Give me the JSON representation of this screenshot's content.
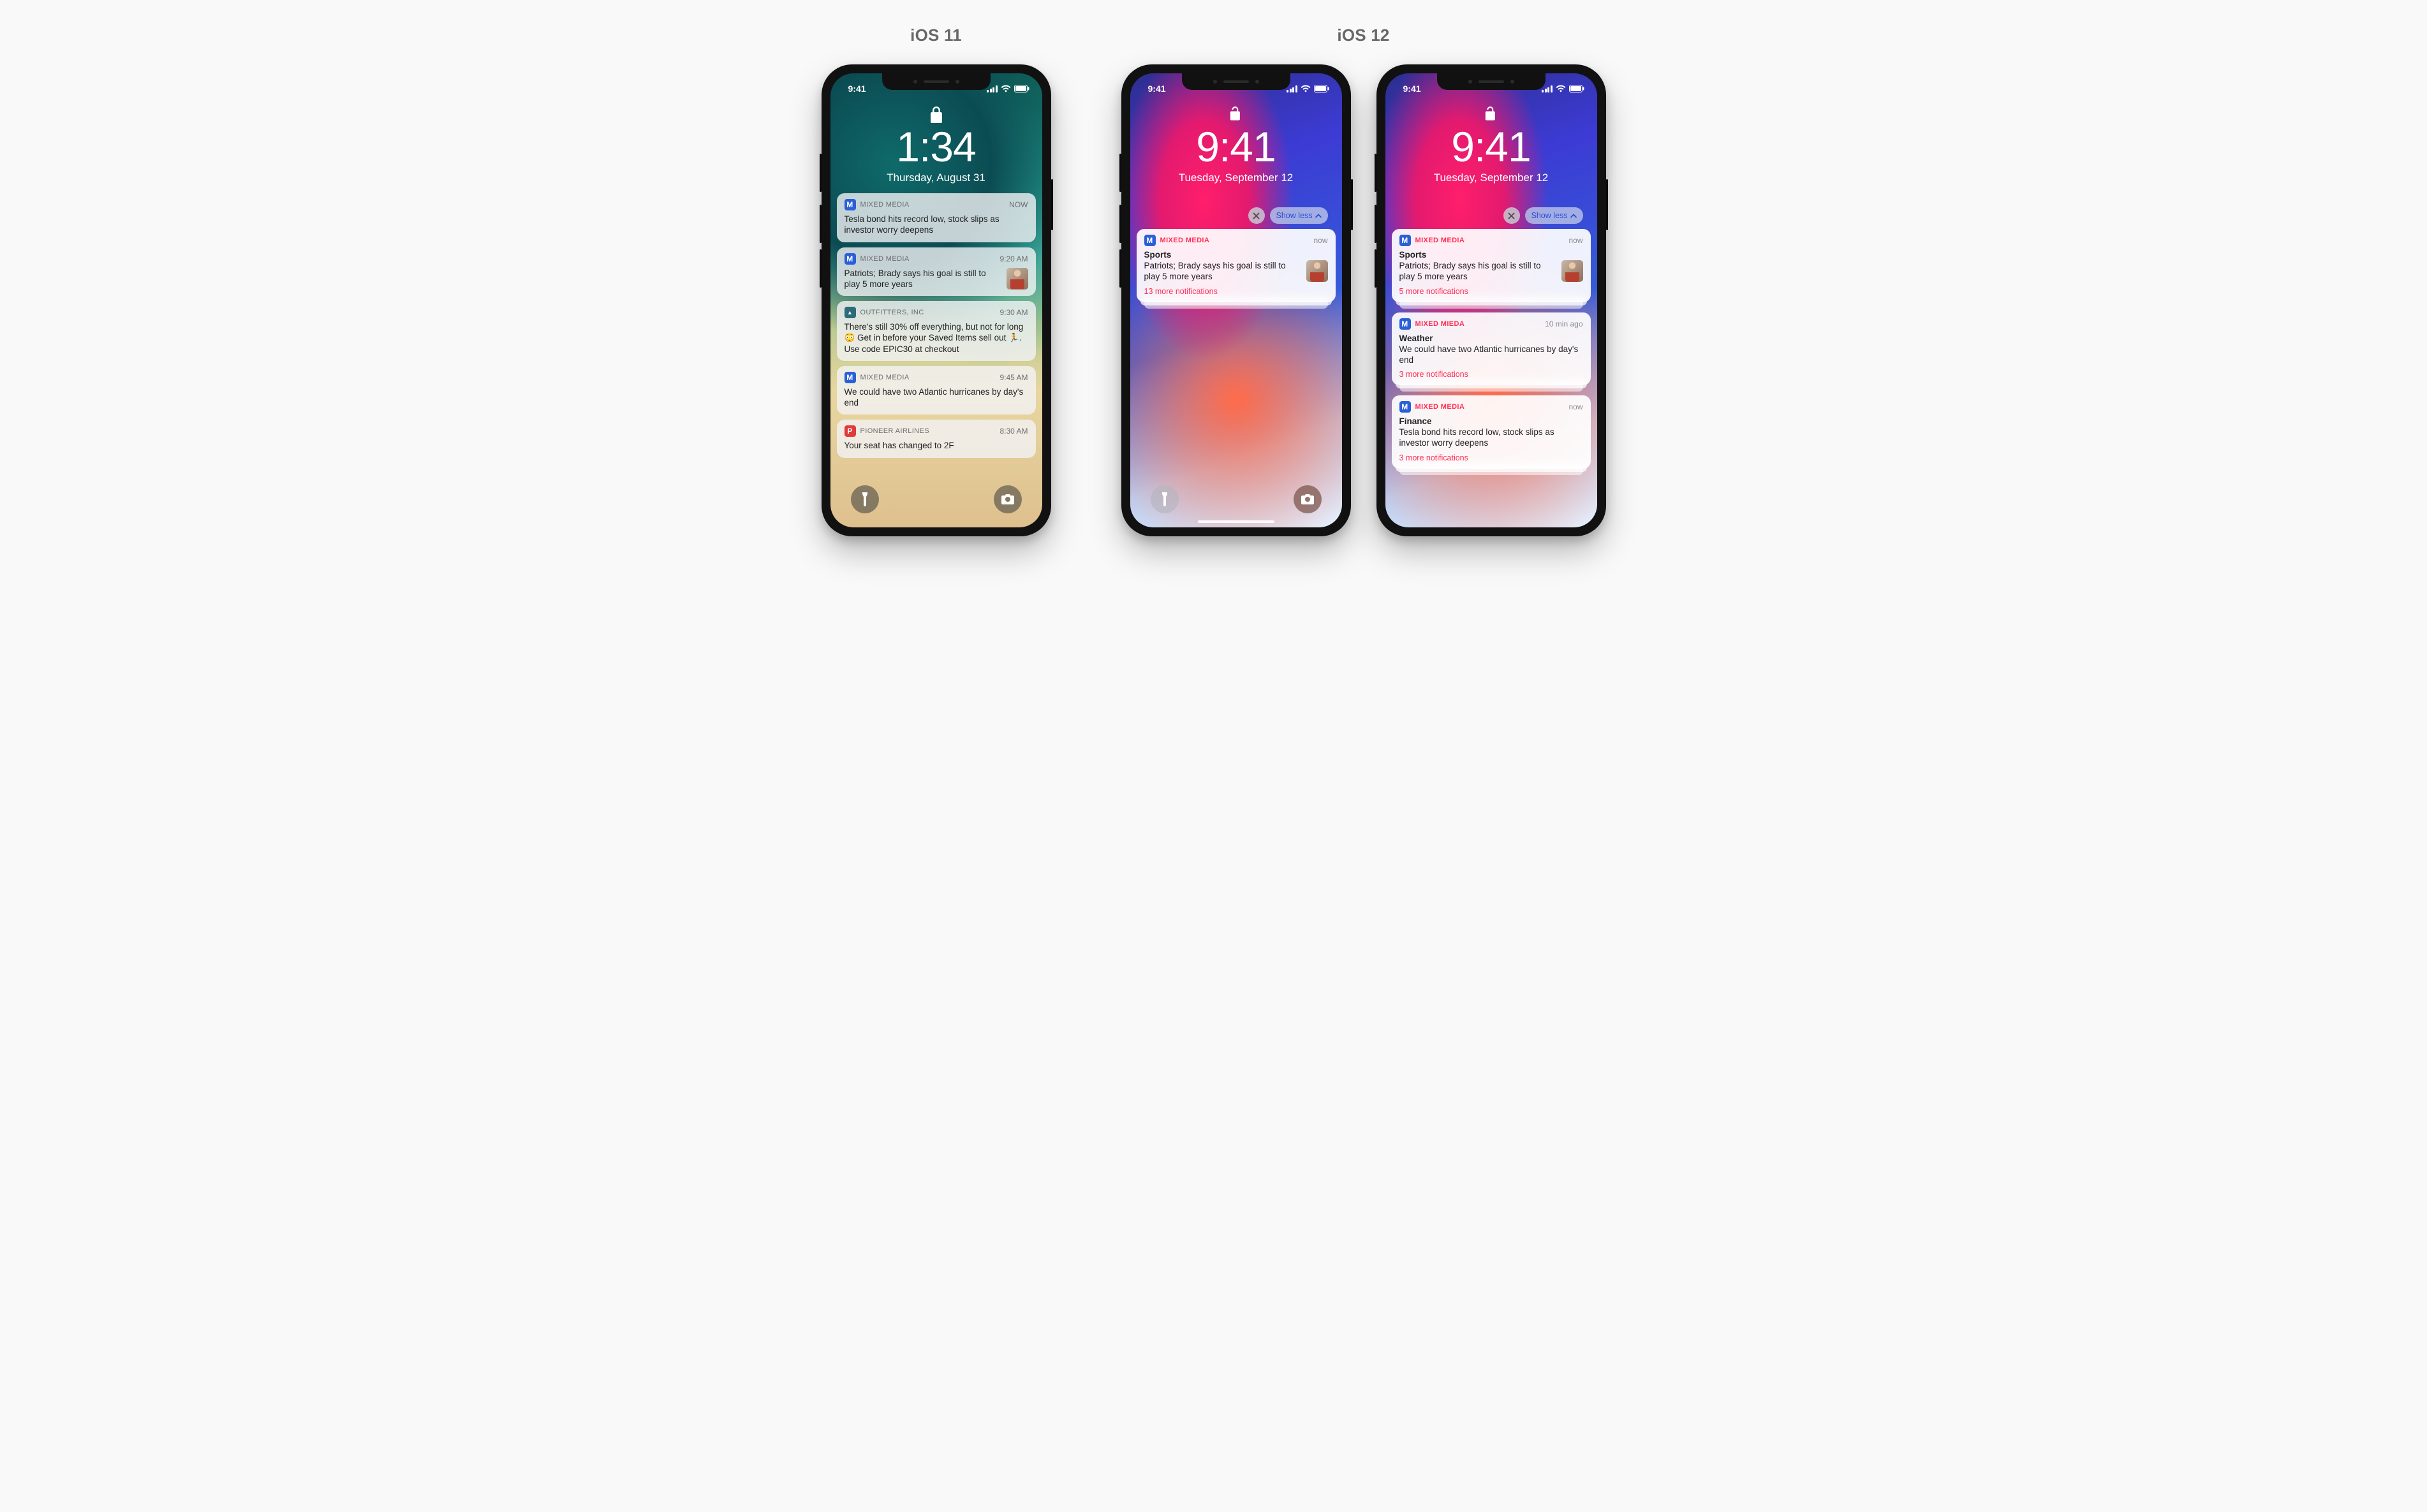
{
  "labels": {
    "ios11": "iOS 11",
    "ios12": "iOS 12"
  },
  "status_time": "9:41",
  "ios11": {
    "clock": "1:34",
    "date": "Thursday, August 31",
    "cards": [
      {
        "app": "MIXED MEDIA",
        "icon": "mm",
        "time": "NOW",
        "body": "Tesla bond hits record low, stock slips as investor worry deepens"
      },
      {
        "app": "MIXED MEDIA",
        "icon": "mm",
        "time": "9:20 AM",
        "body": "Patriots; Brady says his goal is still to play 5 more years",
        "thumb": true
      },
      {
        "app": "OUTFITTERS, INC",
        "icon": "of",
        "time": "9:30 AM",
        "body": "There's still 30% off everything, but not for long 😳 Get in before your Saved Items sell out 🏃. Use code EPIC30 at checkout"
      },
      {
        "app": "MIXED MEDIA",
        "icon": "mm",
        "time": "9:45 AM",
        "body": "We could have two Atlantic hurricanes by day's end"
      },
      {
        "app": "PIONEER AIRLINES",
        "icon": "pa",
        "time": "8:30 AM",
        "body": "Your seat has changed to 2F"
      }
    ]
  },
  "ios12": {
    "clock": "9:41",
    "date": "Tuesday, September 12",
    "show_less": "Show less",
    "phoneA": {
      "card": {
        "app": "MIXED MEDIA",
        "time": "now",
        "title": "Sports",
        "body": "Patriots; Brady says his goal is still to play 5 more years",
        "more": "13 more notifications",
        "thumb": true
      }
    },
    "phoneB": {
      "cards": [
        {
          "app": "MIXED MEDIA",
          "time": "now",
          "title": "Sports",
          "body": "Patriots; Brady says his goal is still to play 5 more years",
          "more": "5 more notifications",
          "thumb": true
        },
        {
          "app": "MIXED MIEDA",
          "time": "10 min ago",
          "title": "Weather",
          "body": "We could have two Atlantic hurricanes by day's end",
          "more": "3 more notifications"
        },
        {
          "app": "MIXED MEDIA",
          "time": "now",
          "title": "Finance",
          "body": "Tesla bond hits record low, stock slips as investor worry deepens",
          "more": "3 more notifications"
        }
      ]
    }
  }
}
